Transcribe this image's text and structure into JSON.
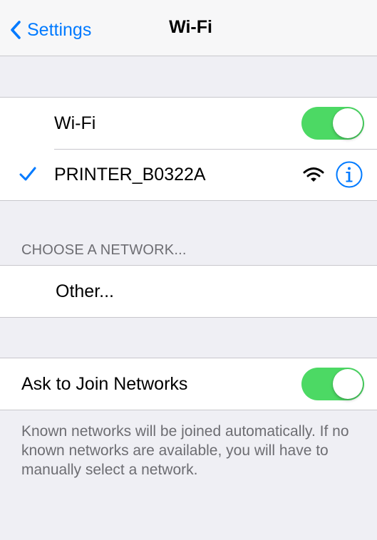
{
  "navbar": {
    "back_label": "Settings",
    "title": "Wi-Fi"
  },
  "wifi_section": {
    "wifi_label": "Wi-Fi",
    "wifi_enabled": true,
    "connected_network": "PRINTER_B0322A"
  },
  "choose_section": {
    "header": "CHOOSE A NETWORK...",
    "other_label": "Other..."
  },
  "ask_section": {
    "label": "Ask to Join Networks",
    "enabled": true,
    "footer": "Known networks will be joined automatically. If no known networks are available, you will have to manually select a network."
  },
  "colors": {
    "accent": "#007aff",
    "toggle_on": "#4cd964",
    "background": "#efeff4"
  },
  "icons": [
    "chevron-left-icon",
    "checkmark-icon",
    "wifi-signal-icon",
    "info-icon"
  ]
}
